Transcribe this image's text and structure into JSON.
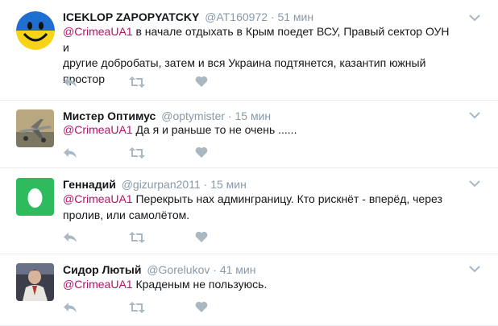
{
  "tweets": [
    {
      "name": "ICEKLOP ZAPOPYATCKY",
      "handle": "@AT160972",
      "dot": "·",
      "time": "51 мин",
      "mention": "@CrimeaUA1",
      "text_line1": " в начале отдыхать в Крым поедет ВСУ, Правый сектор ОУН и",
      "text_line2": "другие добробаты, затем и вся Украина подтянется, казантип южный",
      "text_line3": "простор"
    },
    {
      "name": "Мистер Оптимус",
      "handle": "@optymister",
      "dot": "·",
      "time": "15 мин",
      "mention": "@CrimeaUA1",
      "text_line1": " Да я и раньше то не очень ......"
    },
    {
      "name": "Геннадий",
      "handle": "@gizurpan2011",
      "dot": "·",
      "time": "15 мин",
      "mention": "@CrimeaUA1",
      "text_line1": " Перекрыть нах админграницу. Кто рискнёт - вперёд, через",
      "text_line2": "пролив, или самолётом."
    },
    {
      "name": "Сидор Лютый",
      "handle": "@Gorelukov",
      "dot": "·",
      "time": "41 мин",
      "mention": "@CrimeaUA1",
      "text_line1": " Краденым не пользуюсь."
    }
  ],
  "colors": {
    "mention": "#b3136a",
    "muted": "#8899a6",
    "icon": "#aab8c2",
    "divider": "#e6ecf0",
    "egg_green": "#2dbb5e"
  }
}
